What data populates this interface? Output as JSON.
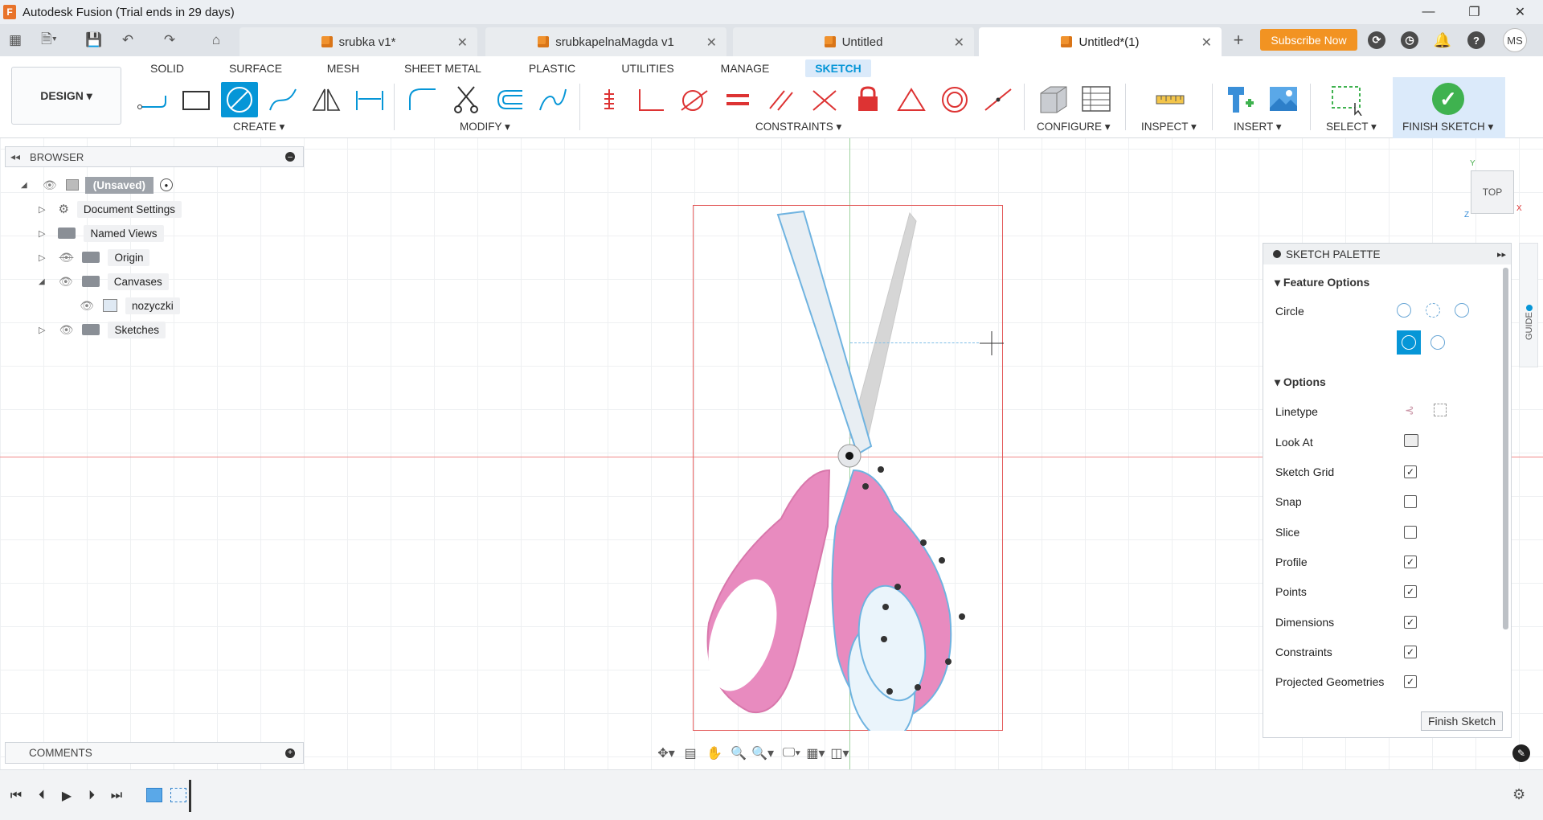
{
  "app": {
    "title": "Autodesk Fusion (Trial ends in 29 days)",
    "logo_letter": "F"
  },
  "tabs": [
    {
      "label": "srubka v1*",
      "active": false
    },
    {
      "label": "srubkapelnaMagda v1",
      "active": false
    },
    {
      "label": "Untitled",
      "active": false
    },
    {
      "label": "Untitled*(1)",
      "active": true
    }
  ],
  "header": {
    "subscribe_label": "Subscribe Now",
    "avatar_initials": "MS",
    "help_label": "?"
  },
  "toolbar": {
    "design_label": "DESIGN ▾",
    "workspaces": [
      "SOLID",
      "SURFACE",
      "MESH",
      "SHEET METAL",
      "PLASTIC",
      "UTILITIES",
      "MANAGE",
      "SKETCH"
    ],
    "active_workspace": "SKETCH",
    "groups": {
      "create": "CREATE ▾",
      "modify": "MODIFY ▾",
      "constraints": "CONSTRAINTS ▾",
      "configure": "CONFIGURE ▾",
      "inspect": "INSPECT ▾",
      "insert": "INSERT ▾",
      "select": "SELECT ▾",
      "finish": "FINISH SKETCH ▾"
    }
  },
  "browser": {
    "title": "BROWSER",
    "root": "(Unsaved)",
    "items": [
      {
        "label": "Document Settings"
      },
      {
        "label": "Named Views"
      },
      {
        "label": "Origin"
      },
      {
        "label": "Canvases"
      },
      {
        "label": "nozyczki"
      },
      {
        "label": "Sketches"
      }
    ]
  },
  "comments": {
    "label": "COMMENTS"
  },
  "viewcube": {
    "face": "TOP",
    "axis_y": "Y",
    "axis_x": "X",
    "axis_z": "Z"
  },
  "palette": {
    "title": "SKETCH PALETTE",
    "feature_options_label": "Feature Options",
    "circle_label": "Circle",
    "options_label": "Options",
    "rows": [
      {
        "label": "Linetype",
        "checked": null
      },
      {
        "label": "Look At",
        "checked": null
      },
      {
        "label": "Sketch Grid",
        "checked": true
      },
      {
        "label": "Snap",
        "checked": false
      },
      {
        "label": "Slice",
        "checked": false
      },
      {
        "label": "Profile",
        "checked": true
      },
      {
        "label": "Points",
        "checked": true
      },
      {
        "label": "Dimensions",
        "checked": true
      },
      {
        "label": "Constraints",
        "checked": true
      },
      {
        "label": "Projected Geometries",
        "checked": true
      }
    ],
    "finish_button": "Finish Sketch"
  },
  "guide": {
    "label": "GUIDE"
  },
  "colors": {
    "accent": "#0696d7",
    "subscribe": "#f29322",
    "finish_green": "#3fb24f",
    "axis_red": "#f08a8a",
    "axis_green": "#9ed39e",
    "scissor_pink": "#e68bbf"
  }
}
